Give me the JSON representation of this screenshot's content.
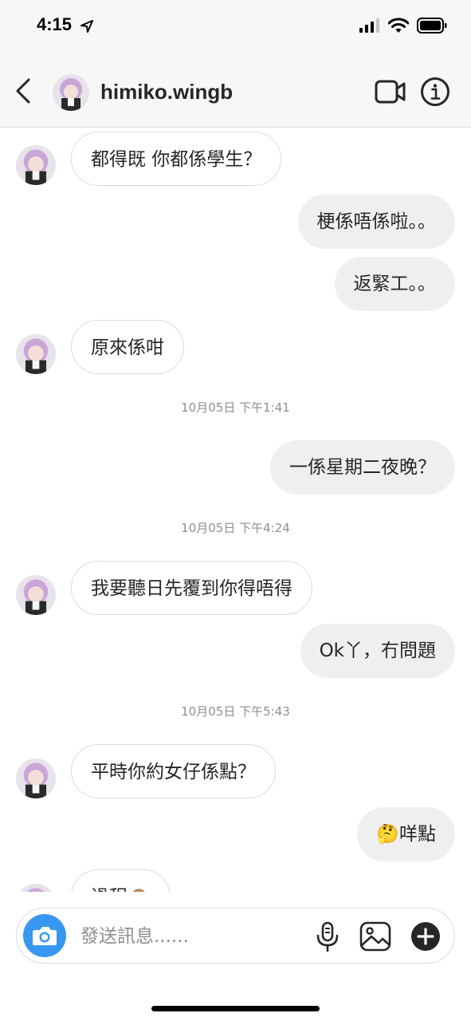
{
  "status_bar": {
    "time": "4:15"
  },
  "header": {
    "username": "himiko.wingb"
  },
  "messages": [
    {
      "type": "in",
      "text": "都得既 你都係學生？"
    },
    {
      "type": "out",
      "text": "梗係唔係啦。。"
    },
    {
      "type": "out",
      "text": "返緊工。。"
    },
    {
      "type": "in",
      "text": "原來係咁"
    },
    {
      "type": "time",
      "text": "10月05日 下午1:41"
    },
    {
      "type": "out",
      "text": "一係星期二夜晚？"
    },
    {
      "type": "time",
      "text": "10月05日 下午4:24"
    },
    {
      "type": "in",
      "text": "我要聽日先覆到你得唔得"
    },
    {
      "type": "out",
      "text": "Ok丫，冇問題"
    },
    {
      "type": "time",
      "text": "10月05日 下午5:43"
    },
    {
      "type": "in",
      "text": "平時你約女仔係點？"
    },
    {
      "type": "out",
      "text": "🤔咩點"
    },
    {
      "type": "in",
      "text": "過程🙈"
    }
  ],
  "composer": {
    "placeholder": "發送訊息......"
  },
  "icons": {
    "back": "chevron-left-icon",
    "video": "video-camera-icon",
    "info": "info-icon",
    "camera": "camera-icon",
    "mic": "microphone-icon",
    "gallery": "gallery-icon",
    "plus": "plus-icon"
  },
  "colors": {
    "accent": "#3897f0",
    "outgoing_bubble": "#efefef",
    "incoming_border": "#dbdbdb"
  }
}
